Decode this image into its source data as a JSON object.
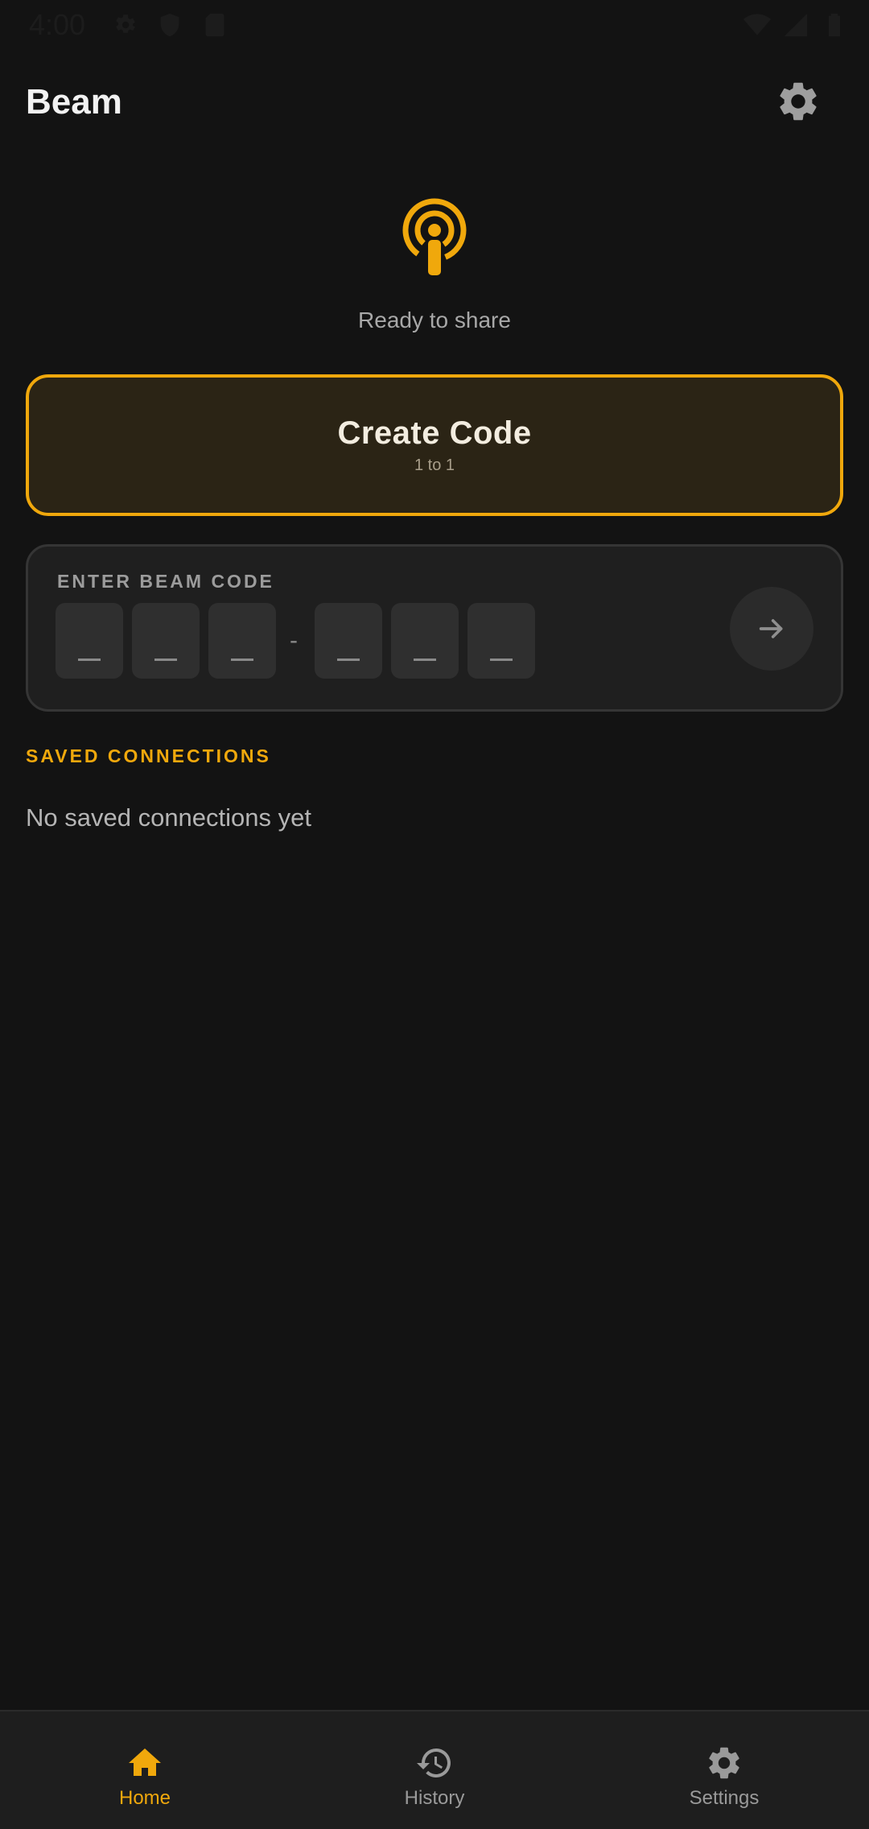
{
  "status_bar": {
    "time": "4:00",
    "left_icons": [
      "settings-icon",
      "shield-icon",
      "sd-card-icon"
    ],
    "right_icons": [
      "wifi-icon",
      "signal-icon",
      "battery-icon"
    ]
  },
  "app_bar": {
    "title": "Beam",
    "settings_icon": "gear-icon"
  },
  "hero": {
    "icon": "broadcast-icon",
    "status_text": "Ready to share"
  },
  "create_code": {
    "title": "Create Code",
    "subtitle": "1 to 1"
  },
  "beam_code": {
    "label": "ENTER BEAM CODE",
    "digits": [
      "",
      "",
      "",
      "",
      "",
      ""
    ],
    "separator": "-",
    "submit_icon": "arrow-right-icon"
  },
  "saved_connections": {
    "header": "SAVED CONNECTIONS",
    "empty_text": "No saved connections yet"
  },
  "bottom_nav": {
    "items": [
      {
        "label": "Home",
        "icon": "home-icon",
        "active": true
      },
      {
        "label": "History",
        "icon": "history-icon",
        "active": false
      },
      {
        "label": "Settings",
        "icon": "gear-icon",
        "active": false
      }
    ]
  },
  "colors": {
    "accent": "#f0a80c",
    "background": "#131313",
    "card": "#1f1f1f"
  }
}
